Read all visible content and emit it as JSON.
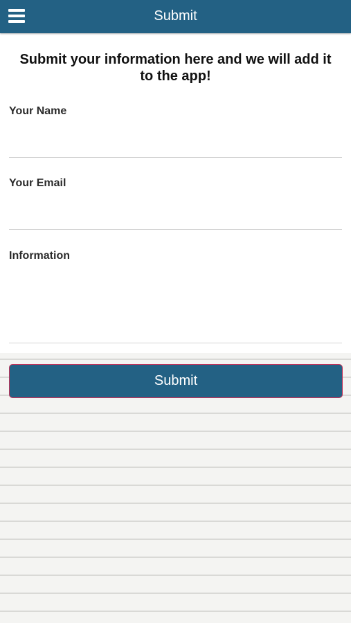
{
  "header": {
    "title": "Submit",
    "menu_icon": "hamburger-menu-icon"
  },
  "form": {
    "intro": "Submit your information here and we will add it to the app!",
    "fields": [
      {
        "label": "Your Name",
        "value": "",
        "placeholder": ""
      },
      {
        "label": "Your Email",
        "value": "",
        "placeholder": ""
      },
      {
        "label": "Information",
        "value": "",
        "placeholder": ""
      }
    ],
    "submit_label": "Submit"
  },
  "colors": {
    "header_bg": "#236184",
    "button_bg": "#236184",
    "button_border": "#c2335a",
    "page_bg": "#f4f4f2"
  }
}
